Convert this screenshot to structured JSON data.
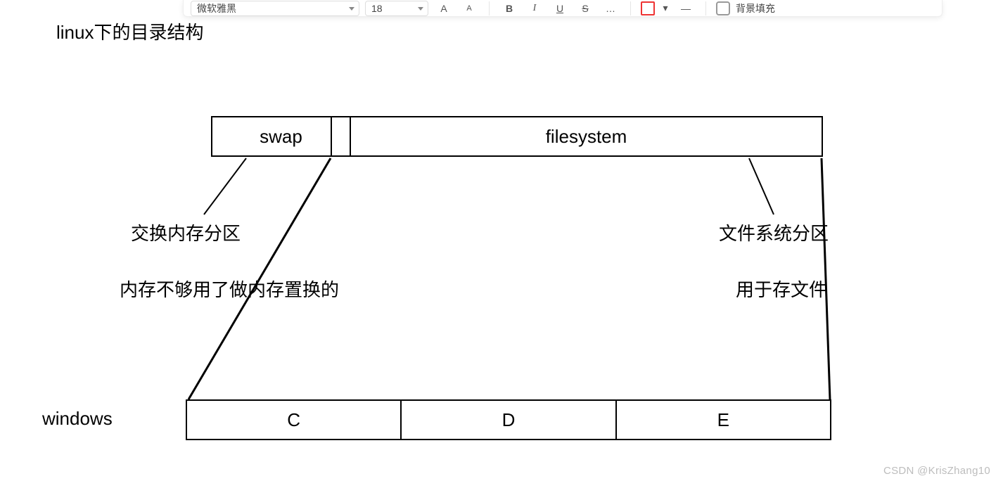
{
  "toolbar": {
    "font_family": "微软雅黑",
    "font_size": "18",
    "bold": "B",
    "italic": "I",
    "underline": "U",
    "strike": "S",
    "background_fill": "背景填充"
  },
  "heading": "linux下的目录结构",
  "linux": {
    "swap": "swap",
    "filesystem": "filesystem"
  },
  "swap_note": {
    "line1": "交换内存分区",
    "line2": "内存不够用了做内存置换的"
  },
  "fs_note": {
    "line1": "文件系统分区",
    "line2": "用于存文件"
  },
  "windows": {
    "label": "windows",
    "c": "C",
    "d": "D",
    "e": "E"
  },
  "watermark": "CSDN @KrisZhang10"
}
